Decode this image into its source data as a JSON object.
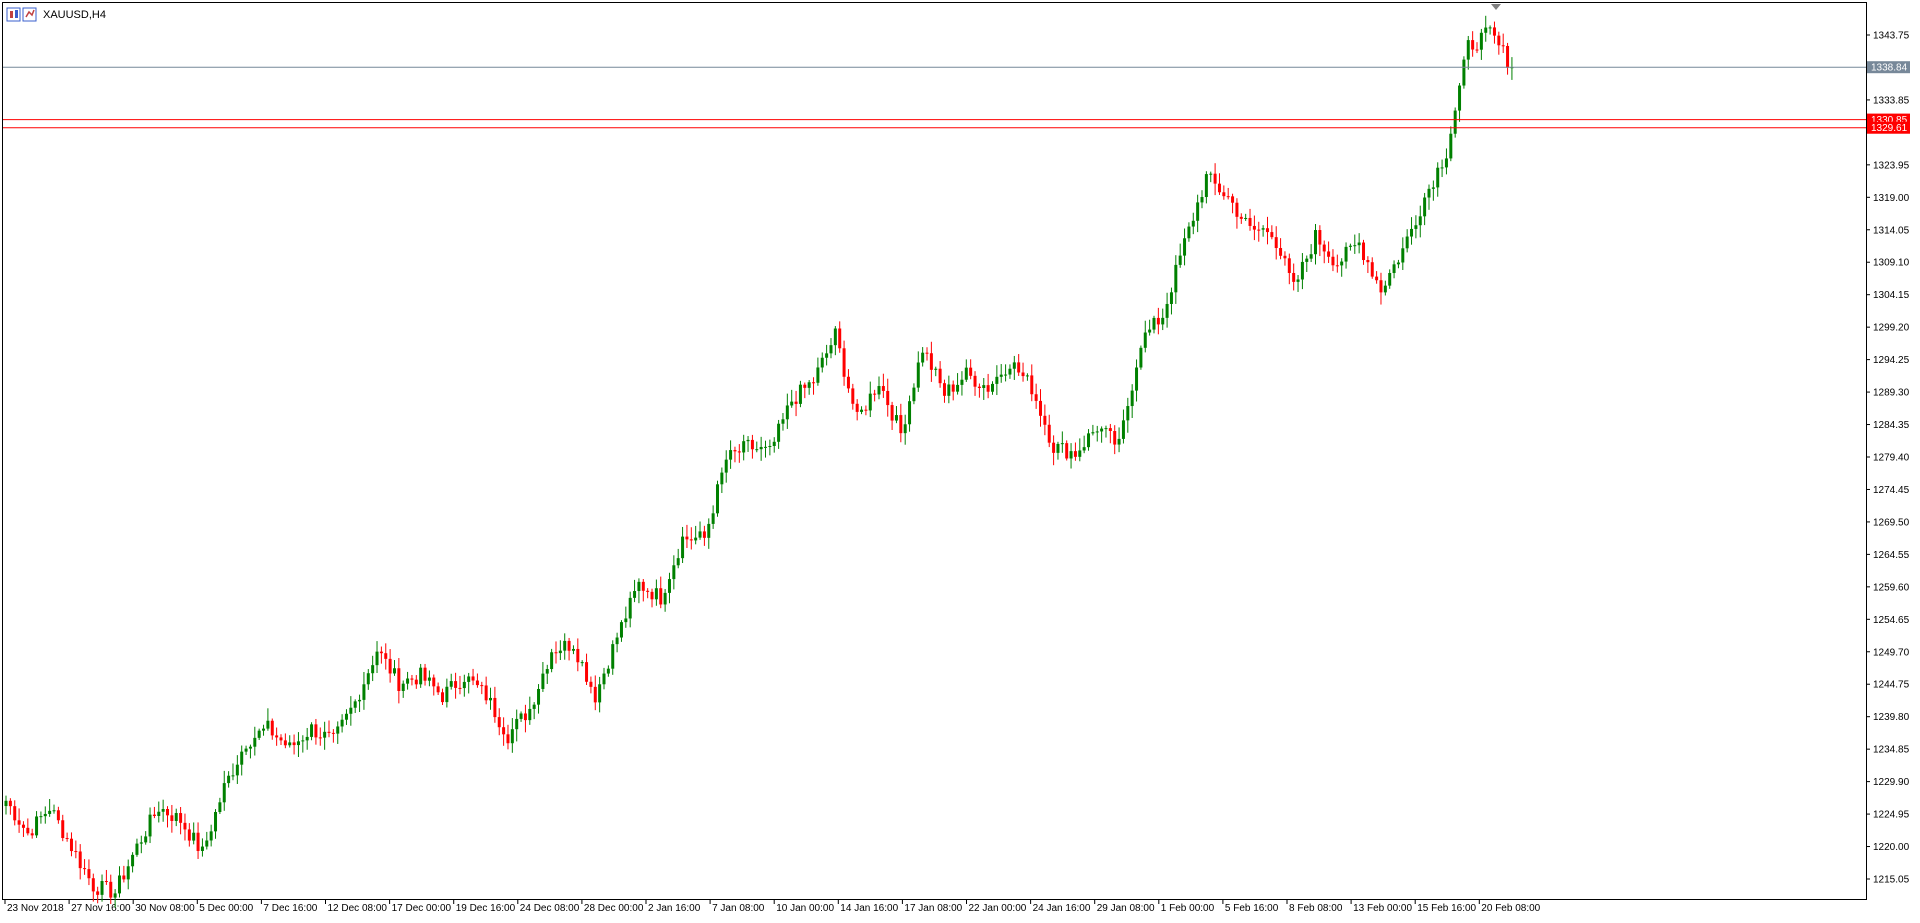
{
  "window": {
    "title": "XAUUSD,H4"
  },
  "colors": {
    "background": "#ffffff",
    "frame": "#000000",
    "bull_candle": "#008000",
    "bear_candle": "#ff0000",
    "bid_line": "#778899",
    "level_line": "#ff0000",
    "bid_label_bg": "#778899",
    "level_label_bg": "#ff0000"
  },
  "chart_data": {
    "type": "candlestick",
    "symbol": "XAUUSD",
    "timeframe": "H4",
    "ylim": [
      1211.5,
      1350.5
    ],
    "price_ticks": [
      "1343.75",
      "1333.85",
      "1323.95",
      "1319.00",
      "1314.05",
      "1309.10",
      "1304.15",
      "1299.20",
      "1294.25",
      "1289.30",
      "1284.35",
      "1279.40",
      "1274.45",
      "1269.50",
      "1264.55",
      "1259.60",
      "1254.65",
      "1249.70",
      "1244.75",
      "1239.80",
      "1234.85",
      "1229.90",
      "1224.95",
      "1220.00",
      "1215.05"
    ],
    "time_ticks": [
      "23 Nov 2018",
      "27 Nov 16:00",
      "30 Nov 08:00",
      "5 Dec 00:00",
      "7 Dec 16:00",
      "12 Dec 08:00",
      "17 Dec 00:00",
      "19 Dec 16:00",
      "24 Dec 08:00",
      "28 Dec 00:00",
      "2 Jan 16:00",
      "7 Jan 08:00",
      "10 Jan 00:00",
      "14 Jan 16:00",
      "17 Jan 08:00",
      "22 Jan 00:00",
      "24 Jan 16:00",
      "29 Jan 08:00",
      "1 Feb 00:00",
      "5 Feb 16:00",
      "8 Feb 08:00",
      "13 Feb 00:00",
      "15 Feb 16:00",
      "20 Feb 08:00"
    ],
    "bid": {
      "label": "1338.84",
      "value": 1338.84
    },
    "levels": [
      {
        "label": "1330.85",
        "value": 1330.85
      },
      {
        "label": "1329.61",
        "value": 1329.61
      }
    ],
    "anchors": [
      1227,
      1222,
      1226,
      1220,
      1214,
      1213,
      1220,
      1226,
      1224,
      1219,
      1229,
      1236,
      1238,
      1235,
      1238,
      1236,
      1242,
      1250,
      1245,
      1246,
      1243,
      1246,
      1243,
      1237,
      1241,
      1250,
      1251,
      1243,
      1252,
      1260,
      1258,
      1267,
      1267,
      1279,
      1281,
      1280,
      1288,
      1291,
      1298,
      1285,
      1291,
      1283,
      1296,
      1289,
      1292,
      1290,
      1294,
      1290,
      1281,
      1280,
      1284,
      1281,
      1297,
      1301,
      1312,
      1322,
      1319,
      1314,
      1314,
      1305,
      1313,
      1309,
      1312,
      1305,
      1311,
      1319,
      1326,
      1342,
      1344,
      1339
    ]
  }
}
